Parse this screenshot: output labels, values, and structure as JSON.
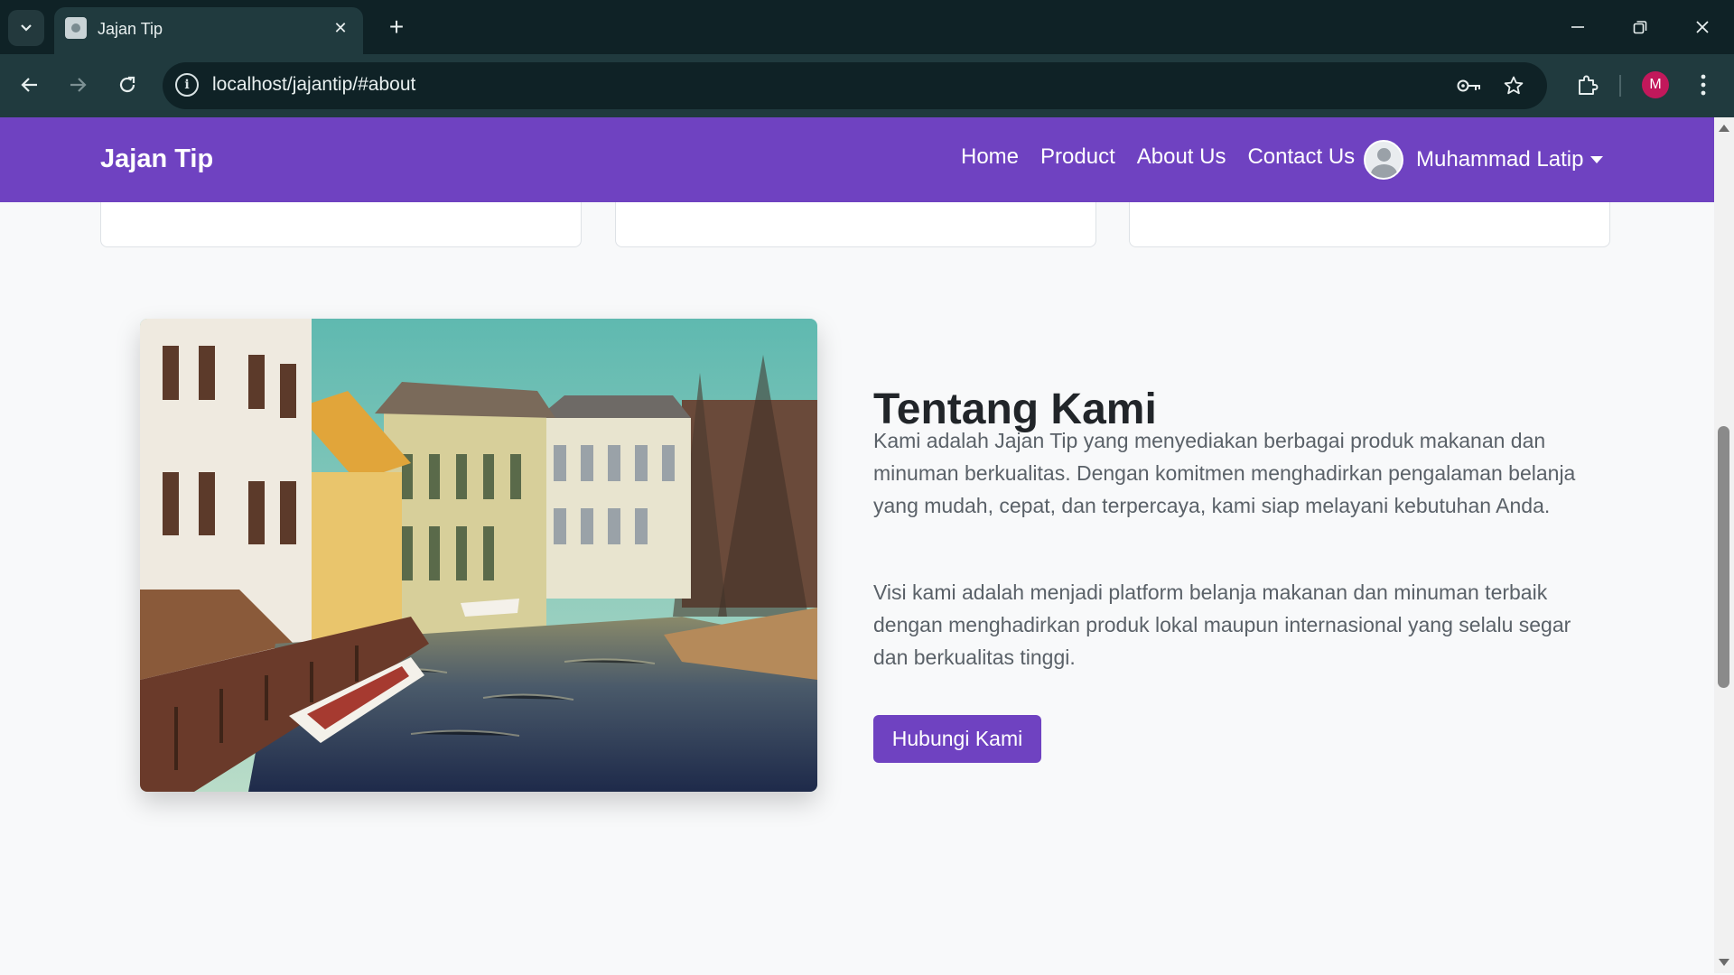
{
  "browser": {
    "tab_title": "Jajan Tip",
    "url": "localhost/jajantip/#about",
    "profile_initial": "M",
    "tab_list_icon": "chevron-down-icon",
    "new_tab_symbol": "+",
    "close_symbol": "✕"
  },
  "navbar": {
    "brand": "Jajan Tip",
    "links": [
      "Home",
      "Product",
      "About Us",
      "Contact Us"
    ],
    "user_name": "Muhammad Latip",
    "bg_color": "#6f42c1"
  },
  "about": {
    "title": "Tentang Kami",
    "paragraph1": "Kami adalah Jajan Tip yang menyediakan berbagai produk makanan dan minuman berkualitas. Dengan komitmen menghadirkan pengalaman belanja yang mudah, cepat, dan terpercaya, kami siap melayani kebutuhan Anda.",
    "paragraph2": "Visi kami adalah menjadi platform belanja makanan dan minuman terbaik dengan menghadirkan produk lokal maupun internasional yang selalu segar dan berkualitas tinggi.",
    "button_label": "Hubungi Kami",
    "accent_color": "#6f42c1"
  }
}
